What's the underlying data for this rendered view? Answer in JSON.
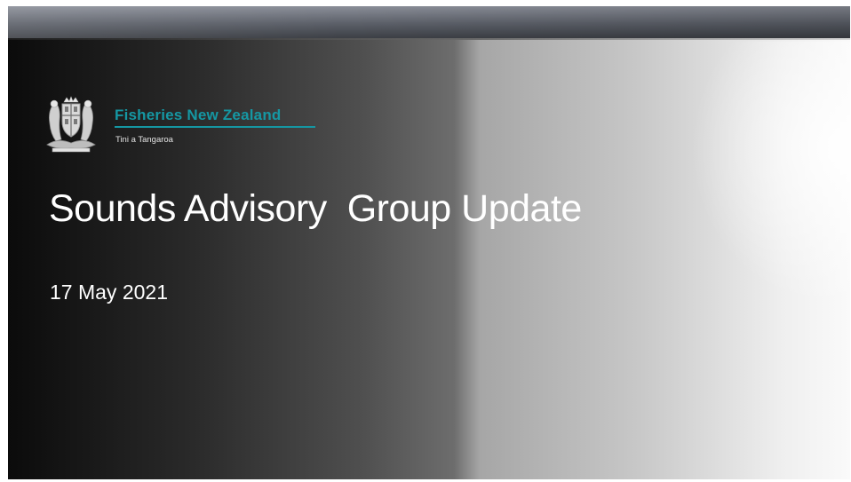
{
  "organization": {
    "name": "Fisheries New Zealand",
    "subtitle": "Tini a Tangaroa",
    "brand_color": "#1597a3"
  },
  "slide": {
    "title": "Sounds Advisory  Group Update",
    "date": "17 May 2021"
  },
  "icons": {
    "crest": "nz-coat-of-arms-icon"
  }
}
